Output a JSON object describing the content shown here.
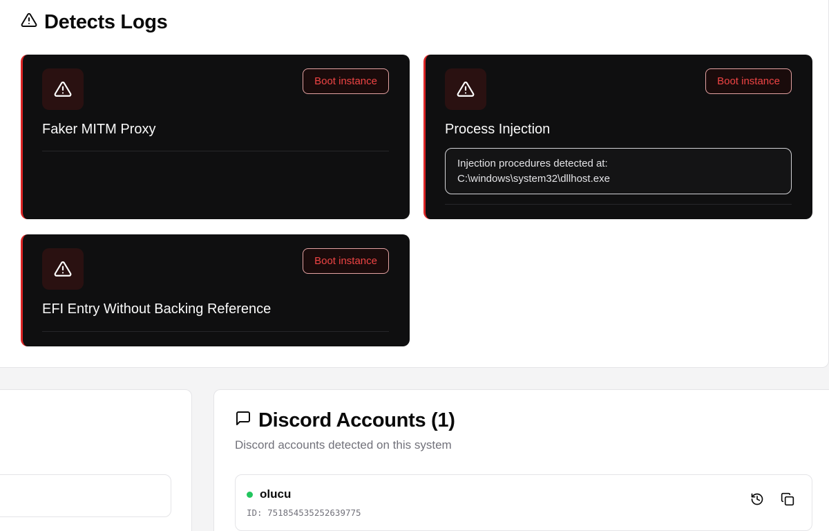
{
  "detects": {
    "title": "Detects Logs",
    "title_icon": "alert-triangle-icon",
    "accent_color": "#dc2626",
    "cards": [
      {
        "title": "Faker MITM Proxy",
        "button": "Boot instance",
        "icon": "alert-triangle-icon"
      },
      {
        "title": "Process Injection",
        "button": "Boot instance",
        "icon": "alert-triangle-icon",
        "detail_line1": "Injection procedures detected at:",
        "detail_line2": "C:\\windows\\system32\\dllhost.exe"
      },
      {
        "title": "EFI Entry Without Backing Reference",
        "button": "Boot instance",
        "icon": "alert-triangle-icon"
      }
    ]
  },
  "discord": {
    "title": "Discord Accounts (1)",
    "title_icon": "message-square-icon",
    "subtitle": "Discord accounts detected on this system",
    "accounts": [
      {
        "name": "olucu",
        "id": "ID: 751854535252639775",
        "status_color": "#22c55e",
        "actions": [
          "history-icon",
          "copy-icon"
        ]
      }
    ]
  }
}
